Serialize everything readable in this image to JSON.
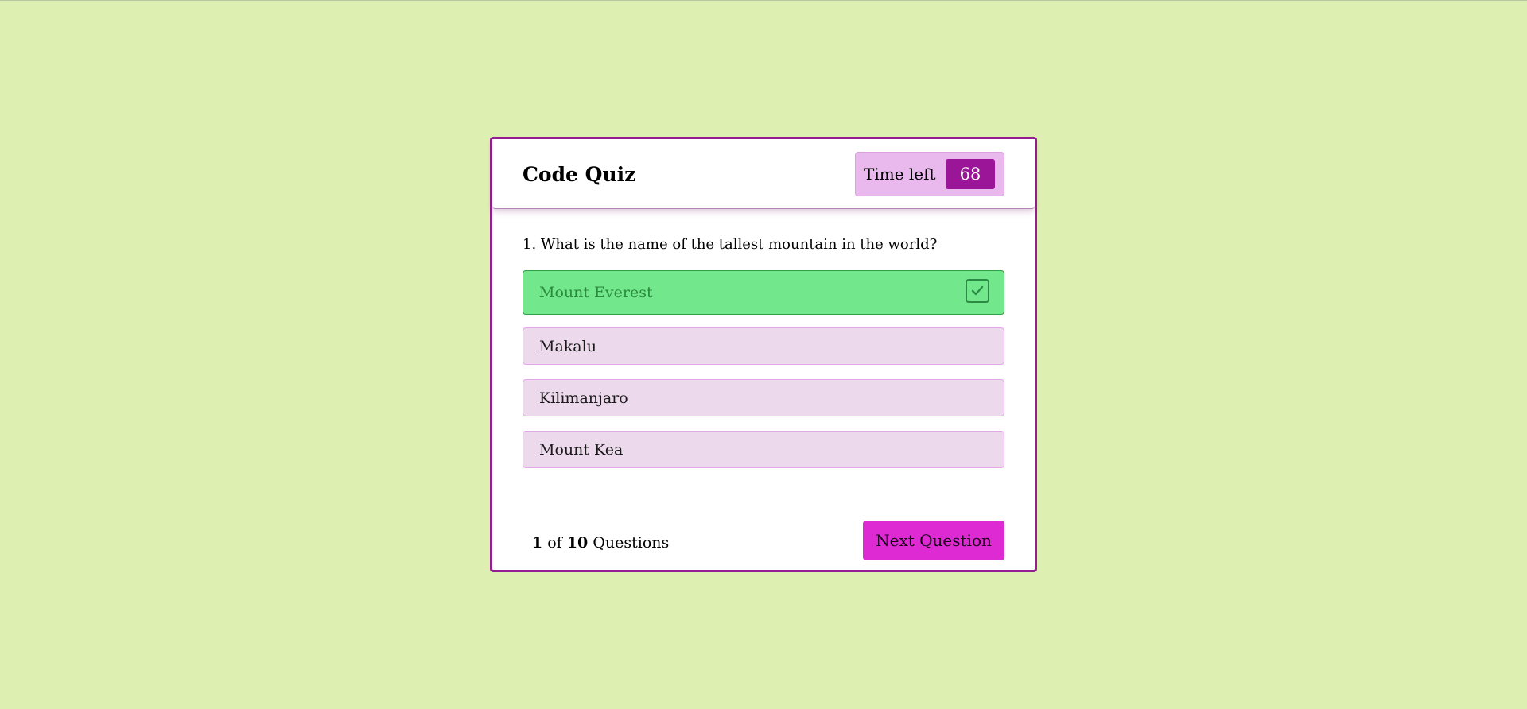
{
  "header": {
    "title": "Code Quiz",
    "timer_label": "Time left",
    "timer_value": "68"
  },
  "question": {
    "text": "1. What is the name of the tallest mountain in the world?"
  },
  "options": [
    {
      "label": "Mount Everest",
      "state": "correct"
    },
    {
      "label": "Makalu",
      "state": "unselected"
    },
    {
      "label": "Kilimanjaro",
      "state": "unselected"
    },
    {
      "label": "Mount Kea",
      "state": "unselected"
    }
  ],
  "footer": {
    "current": "1",
    "of_text": "of",
    "total": "10",
    "suffix": "Questions",
    "next_label": "Next Question"
  },
  "colors": {
    "background": "#def0b1",
    "accent": "#921e8f",
    "correct": "#73e78c",
    "option": "#ecd9ec",
    "next_button": "#dd2ad3"
  },
  "icons": {
    "correct_marker": "check-icon"
  }
}
